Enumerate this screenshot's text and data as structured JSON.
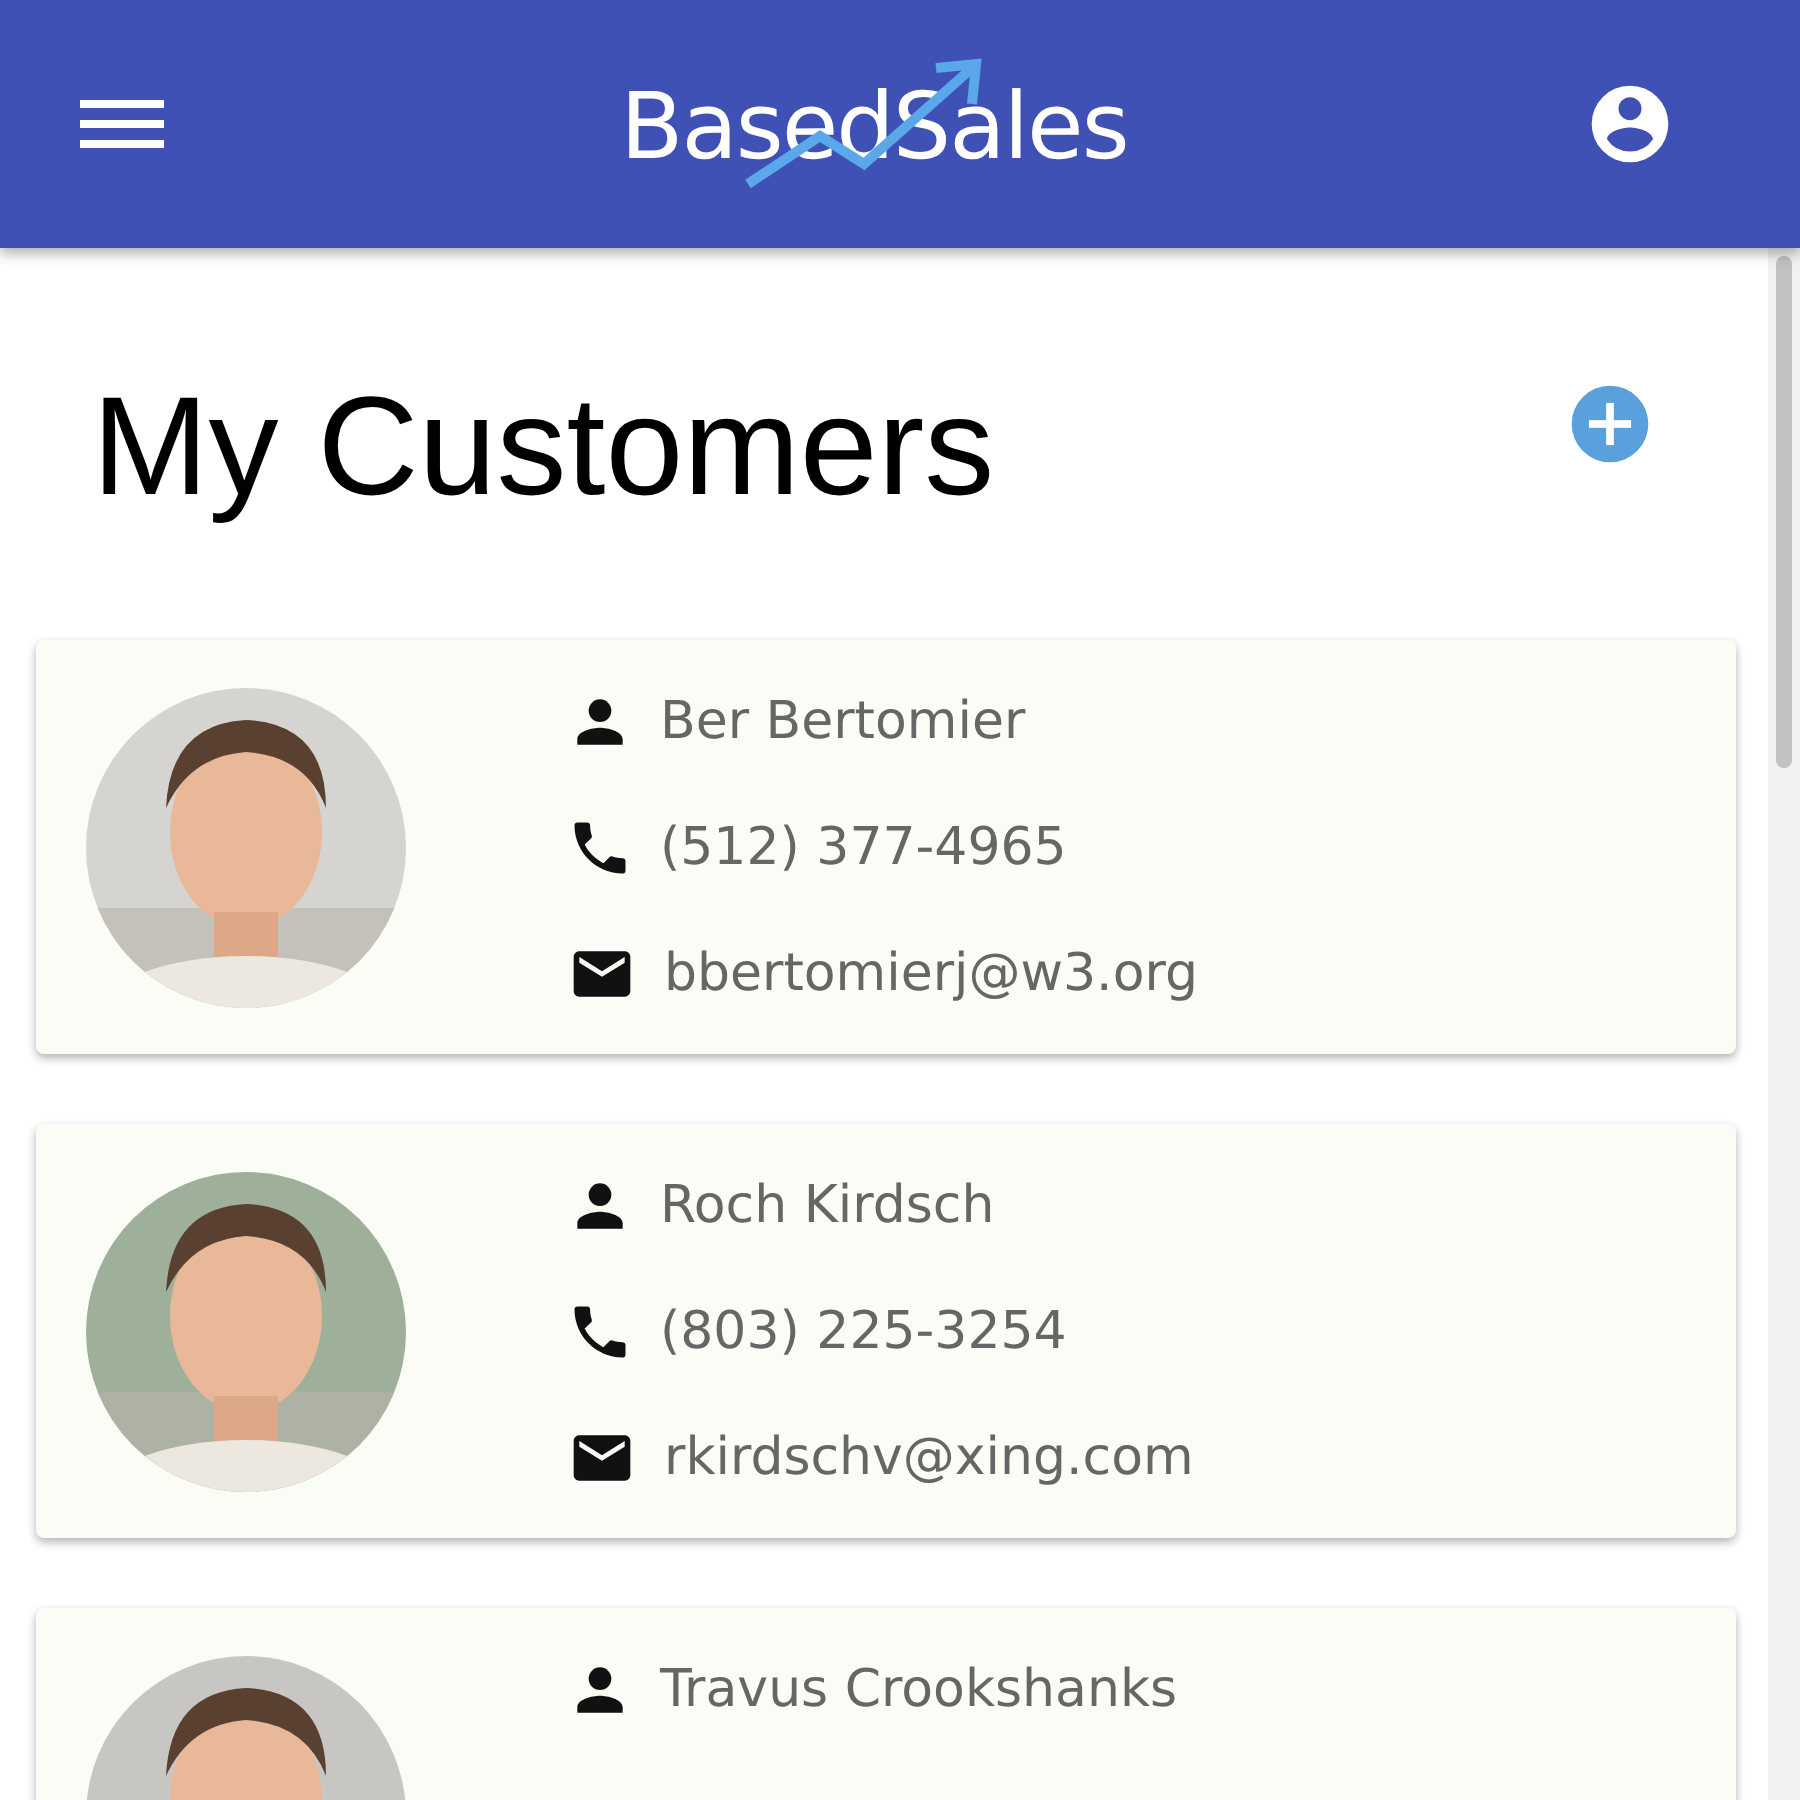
{
  "app_bar": {
    "logo": "BasedSales"
  },
  "page_title": "My Customers",
  "customers": [
    {
      "name": "Ber Bertomier",
      "phone": "(512) 377-4965",
      "email": "bbertomierj@w3.org"
    },
    {
      "name": "Roch Kirdsch",
      "phone": "(803) 225-3254",
      "email": "rkirdschv@xing.com"
    },
    {
      "name": "Travus Crookshanks"
    }
  ]
}
